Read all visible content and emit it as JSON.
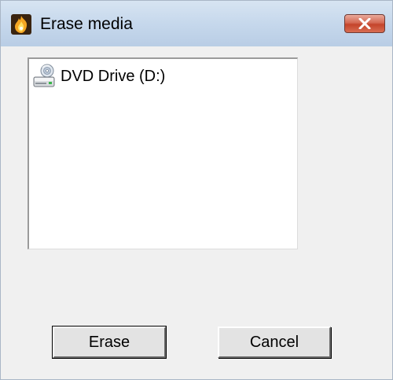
{
  "window": {
    "title": "Erase media",
    "app_icon": "app-flame-icon",
    "close_icon": "close-icon",
    "colors": {
      "titlebar": "#c6d8ec",
      "close_button": "#c4442b",
      "client_background": "#f0f0f0"
    }
  },
  "drive_list": {
    "items": [
      {
        "label": "DVD Drive (D:)",
        "icon": "dvd-drive-icon"
      }
    ]
  },
  "buttons": {
    "erase_label": "Erase",
    "cancel_label": "Cancel"
  }
}
